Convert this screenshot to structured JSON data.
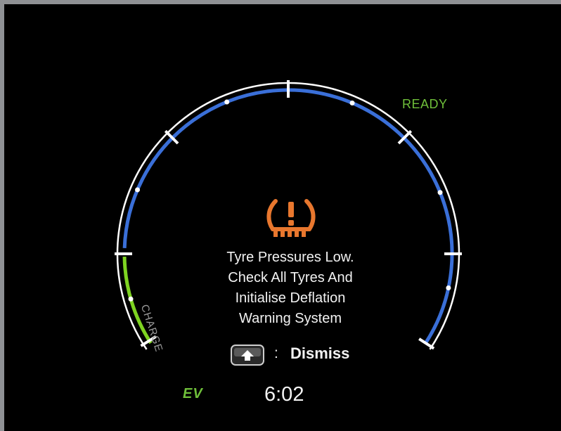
{
  "status": {
    "ready": "READY",
    "ev": "EV",
    "time": "6:02"
  },
  "gauge": {
    "charge_label": "CHARGE",
    "colors": {
      "power_arc": "#3a6fd8",
      "charge_arc": "#7ed321",
      "outer_ring": "#ffffff",
      "ticks": "#ffffff"
    }
  },
  "warning": {
    "icon": "tire-pressure-warning-icon",
    "icon_color": "#e8772e",
    "lines": [
      "Tyre Pressures Low.",
      "Check All Tyres And",
      "Initialise Deflation",
      "Warning System"
    ]
  },
  "dismiss": {
    "button_icon": "steering-button-icon",
    "colon": ":",
    "label": "Dismiss"
  }
}
